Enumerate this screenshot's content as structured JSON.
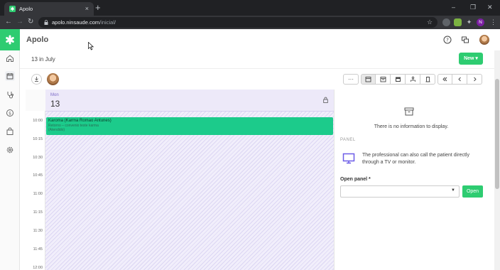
{
  "browser": {
    "tab_title": "Apolo",
    "tab_close": "×",
    "new_tab": "+",
    "url_host": "apolo.ninsaude.com",
    "url_path": "/inicial/",
    "win_min": "–",
    "win_max": "❐",
    "win_close": "✕",
    "back": "←",
    "forward": "→",
    "reload": "↻",
    "profile_initial": "N",
    "menu_dots": "⋮",
    "star": "☆"
  },
  "app": {
    "title": "Apolo",
    "page_title": "13 in July",
    "new_button": "New ▾",
    "accent_color": "#2ecc71"
  },
  "calendar": {
    "day_name": "Mon",
    "day_number": "13",
    "more_button": "···",
    "times": [
      "10:00",
      "10:15",
      "10:30",
      "10:45",
      "11:00",
      "11:15",
      "11:30",
      "11:45",
      "12:00"
    ],
    "event": {
      "title": "Karoma (Karma Romao Antunes)",
      "subtitle": "Retorno – convenio teste karma",
      "status": "(Atendido)"
    }
  },
  "panel": {
    "empty_text": "There is no information to display.",
    "section_label": "PANEL",
    "description": "The professional can also call the patient directly through a TV or monitor.",
    "open_panel_label": "Open panel *",
    "open_button": "Open"
  }
}
